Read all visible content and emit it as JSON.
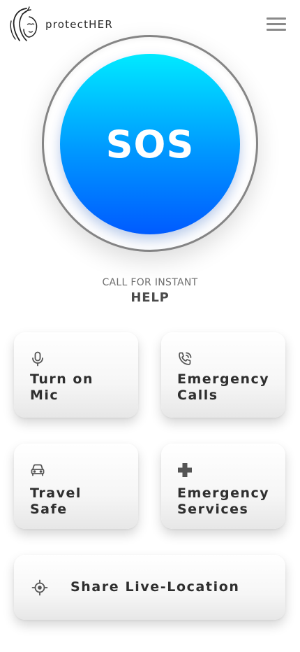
{
  "brand": {
    "name": "protectHER",
    "logo_icon": "woman-face-logo"
  },
  "header": {
    "menu_icon": "hamburger-menu-icon"
  },
  "sos": {
    "label": "SOS",
    "gradient_top": "#00eaff",
    "gradient_bottom": "#005bff"
  },
  "call": {
    "line1": "CALL FOR INSTANT",
    "line2": "HELP"
  },
  "actions": {
    "mic": {
      "label": "Turn on\nMic",
      "icon": "microphone-icon"
    },
    "calls": {
      "label": "Emergency\nCalls",
      "icon": "phone-call-icon"
    },
    "travel": {
      "label": "Travel\nSafe",
      "icon": "car-icon"
    },
    "services": {
      "label": "Emergency\nServices",
      "icon": "plus-icon"
    },
    "location": {
      "label": "Share Live-Location",
      "icon": "location-target-icon"
    }
  }
}
